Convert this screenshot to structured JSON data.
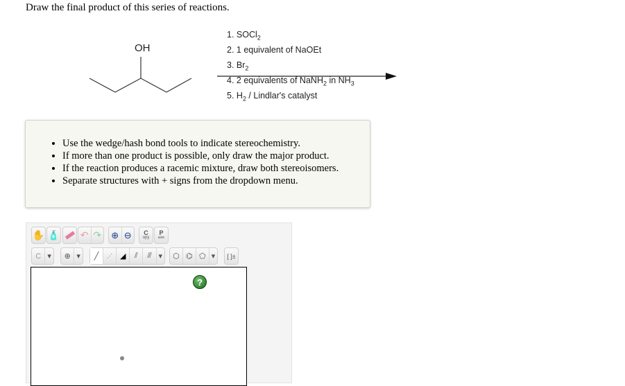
{
  "question": "Draw the final product of this series of reactions.",
  "molecule": {
    "label": "OH"
  },
  "reagents": [
    [
      {
        "t": "1. SOCl"
      },
      {
        "s": "2"
      }
    ],
    [
      {
        "t": "2. 1 equivalent of NaOEt"
      }
    ],
    [
      {
        "t": "3. Br"
      },
      {
        "s": "2"
      }
    ],
    [
      {
        "t": "4. 2 equivalents of NaNH"
      },
      {
        "s": "2"
      },
      {
        "t": " in NH"
      },
      {
        "s": "3"
      }
    ],
    [
      {
        "t": "5. H"
      },
      {
        "s": "2"
      },
      {
        "t": " / Lindlar's catalyst"
      }
    ]
  ],
  "instructions": [
    "Use the wedge/hash bond tools to indicate stereochemistry.",
    "If more than one product is possible, only draw the major product.",
    "If the reaction produces a racemic mixture, draw both stereoisomers.",
    "Separate structures with + signs from the dropdown menu."
  ],
  "toolbar": {
    "copy_top": "C",
    "copy_sub": "opy",
    "paste_top": "P",
    "paste_sub": "aste",
    "atom": "C",
    "charge": "⊕",
    "bracket": "[ ]±",
    "help": "?"
  }
}
